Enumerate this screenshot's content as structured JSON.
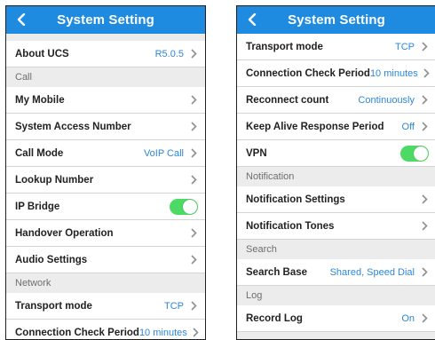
{
  "left": {
    "title": "System Setting",
    "about": {
      "label": "About UCS",
      "value": "R5.0.5"
    },
    "call_section": "Call",
    "my_mobile": "My Mobile",
    "system_access_number": "System Access Number",
    "call_mode": {
      "label": "Call Mode",
      "value": "VoIP Call"
    },
    "lookup_number": "Lookup Number",
    "ip_bridge": {
      "label": "IP Bridge",
      "on": true
    },
    "handover_operation": "Handover Operation",
    "audio_settings": "Audio Settings",
    "network_section": "Network",
    "transport_mode": {
      "label": "Transport mode",
      "value": "TCP"
    },
    "connection_check_period": {
      "label": "Connection Check Period",
      "value": "10 minutes"
    }
  },
  "right": {
    "title": "System Setting",
    "transport_mode": {
      "label": "Transport mode",
      "value": "TCP"
    },
    "connection_check_period": {
      "label": "Connection Check Period",
      "value": "10 minutes"
    },
    "reconnect_count": {
      "label": "Reconnect count",
      "value": "Continuously"
    },
    "keep_alive": {
      "label": "Keep Alive Response Period",
      "value": "Off"
    },
    "vpn": {
      "label": "VPN",
      "on": true
    },
    "notification_section": "Notification",
    "notification_settings": "Notification Settings",
    "notification_tones": "Notification Tones",
    "search_section": "Search",
    "search_base": {
      "label": "Search Base",
      "value": "Shared, Speed Dial"
    },
    "log_section": "Log",
    "record_log": {
      "label": "Record Log",
      "value": "On"
    }
  },
  "colors": {
    "header": "#1e8be0",
    "value": "#2f86d6",
    "toggle_on": "#4cd964",
    "section_bg": "#ececec"
  },
  "icons": {
    "back": "chevron-left-icon",
    "row_arrow": "chevron-right-icon"
  }
}
